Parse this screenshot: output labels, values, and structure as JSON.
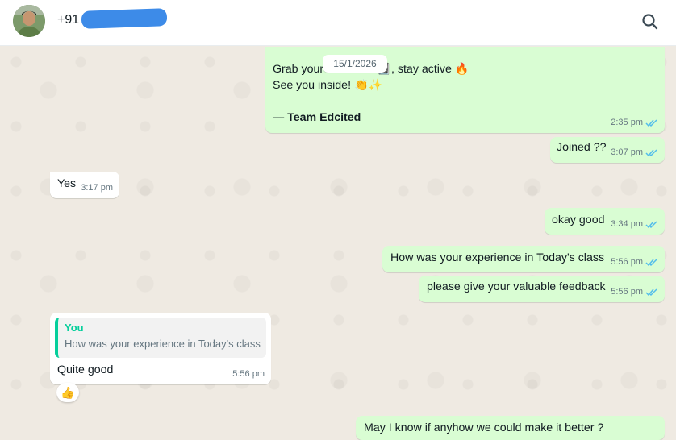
{
  "header": {
    "contact_name": "+91",
    "search_icon": "search-icon"
  },
  "date_separator": "15/1/2026",
  "messages": [
    {
      "direction": "outgoing",
      "lines": [
        "Grab your notebook 📓, stay active 🔥",
        "See you inside! 👏✨",
        "",
        "— Team Edcited"
      ],
      "time": "2:35 pm",
      "status": "read"
    },
    {
      "direction": "outgoing",
      "text": "Joined ??",
      "time": "3:07 pm",
      "status": "read"
    },
    {
      "direction": "incoming",
      "text": "Yes",
      "time": "3:17 pm"
    },
    {
      "direction": "outgoing",
      "text": "okay good",
      "time": "3:34 pm",
      "status": "read"
    },
    {
      "direction": "outgoing",
      "text": "How was your experience in Today's class",
      "time": "5:56 pm",
      "status": "read"
    },
    {
      "direction": "outgoing",
      "text": "please give your valuable feedback",
      "time": "5:56 pm",
      "status": "read"
    },
    {
      "direction": "incoming",
      "quote_author": "You",
      "quote_text": "How was your experience in Today's class",
      "text": "Quite good",
      "time": "5:56 pm",
      "reaction": "👍"
    },
    {
      "direction": "outgoing",
      "text": "May I know if anyhow we could make it better ?"
    }
  ],
  "colors": {
    "outgoing_bubble": "#d9fdd3",
    "incoming_bubble": "#ffffff",
    "read_tick": "#53bdeb",
    "quote_accent": "#06cf9c",
    "wallpaper": "#efeae2"
  }
}
